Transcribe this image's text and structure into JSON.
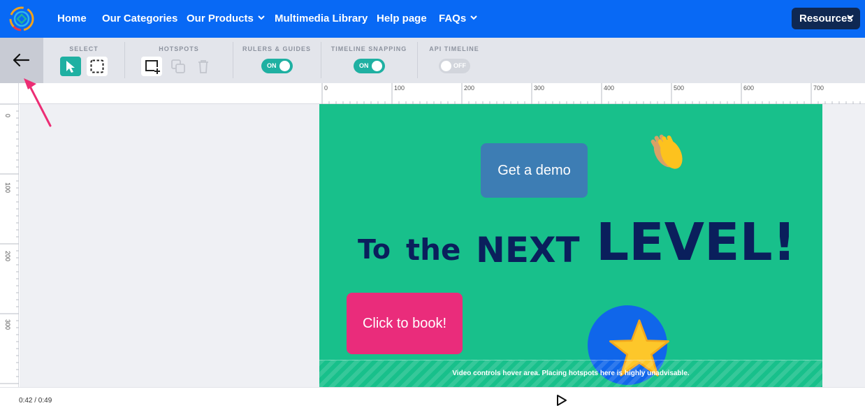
{
  "nav": {
    "items": [
      {
        "label": "Home",
        "has_dropdown": false
      },
      {
        "label": "Our Categories",
        "has_dropdown": false
      },
      {
        "label": "Our Products",
        "has_dropdown": true
      },
      {
        "label": "Multimedia Library",
        "has_dropdown": false
      },
      {
        "label": "Help page",
        "has_dropdown": false
      },
      {
        "label": "FAQs",
        "has_dropdown": true
      }
    ],
    "resources_label": "Resources",
    "colors": {
      "bar": "#0869f5",
      "resources_bg": "#0f2852"
    }
  },
  "toolbar": {
    "select": {
      "label": "SELECT",
      "tools": [
        "pointer-tool",
        "marquee-select-tool"
      ],
      "active": "pointer-tool"
    },
    "hotspots": {
      "label": "HOTSPOTS",
      "tools": [
        "add-hotspot-tool",
        "duplicate-tool",
        "delete-tool"
      ]
    },
    "rulers_guides": {
      "label": "RULERS & GUIDES",
      "state": "ON"
    },
    "timeline_snapping": {
      "label": "TIMELINE SNAPPING",
      "state": "ON"
    },
    "api_timeline": {
      "label": "API TIMELINE",
      "state": "OFF"
    }
  },
  "rulers": {
    "horizontal_labels": [
      "0",
      "100",
      "200",
      "300",
      "400",
      "500",
      "600",
      "700"
    ],
    "vertical_labels": [
      "0",
      "100",
      "200",
      "300"
    ]
  },
  "slide": {
    "background": "#18c08b",
    "demo_button": "Get a demo",
    "book_button": "Click to book!",
    "headline": {
      "w1": "To",
      "w2": "the",
      "w3": "NEXT",
      "w4": "LEVEL!"
    },
    "hover_area_text": "Video controls hover area. Placing hotspots here is highly unadvisable."
  },
  "timeline": {
    "time": "0:42 / 0:49"
  }
}
